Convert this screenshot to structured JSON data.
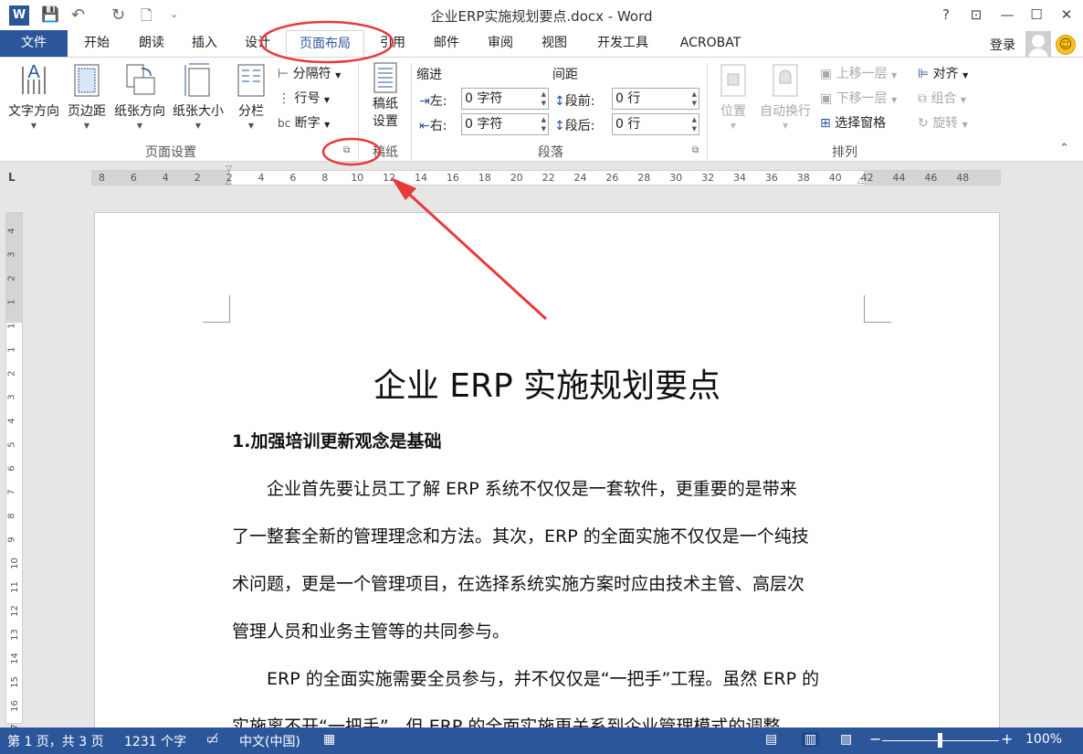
{
  "window": {
    "title": "企业ERP实施规划要点.docx - Word",
    "help": "?",
    "ribbon_display": "⊡",
    "minimize": "—",
    "maximize": "☐",
    "close": "✕"
  },
  "qat": {
    "app_icon": "W",
    "save": "💾",
    "undo": "↶",
    "redo": "↻",
    "print_preview": "🗋",
    "customize": "⌄"
  },
  "tabs": [
    {
      "label": "文件"
    },
    {
      "label": "开始"
    },
    {
      "label": "朗读"
    },
    {
      "label": "插入"
    },
    {
      "label": "设计"
    },
    {
      "label": "页面布局",
      "active": true
    },
    {
      "label": "引用"
    },
    {
      "label": "邮件"
    },
    {
      "label": "审阅"
    },
    {
      "label": "视图"
    },
    {
      "label": "开发工具"
    },
    {
      "label": "ACROBAT"
    }
  ],
  "account": {
    "login": "登录",
    "smiley": "☺"
  },
  "ribbon": {
    "page_setup": {
      "label": "页面设置",
      "text_direction": "文字方向",
      "margins": "页边距",
      "orientation": "纸张方向",
      "size": "纸张大小",
      "columns": "分栏",
      "breaks": "分隔符",
      "line_numbers": "行号",
      "hyphenation": "断字",
      "launcher": "⧉"
    },
    "manuscript": {
      "label": "稿纸",
      "settings_line1": "稿纸",
      "settings_line2": "设置"
    },
    "paragraph": {
      "label": "段落",
      "indent": "缩进",
      "spacing": "间距",
      "left_label": "左:",
      "right_label": "右:",
      "before_label": "段前:",
      "after_label": "段后:",
      "left_value": "0 字符",
      "right_value": "0 字符",
      "before_value": "0 行",
      "after_value": "0 行"
    },
    "arrange": {
      "label": "排列",
      "position": "位置",
      "wrap_text": "自动换行",
      "bring_forward": "上移一层",
      "send_backward": "下移一层",
      "selection_pane": "选择窗格",
      "align": "对齐",
      "group": "组合",
      "rotate": "旋转"
    },
    "collapse": "⌃"
  },
  "ruler": {
    "corner": "L",
    "h_ticks": [
      "8",
      "6",
      "4",
      "2",
      "2",
      "4",
      "6",
      "8",
      "10",
      "12",
      "14",
      "16",
      "18",
      "20",
      "22",
      "24",
      "26",
      "28",
      "30",
      "32",
      "34",
      "36",
      "38",
      "40",
      "42",
      "44",
      "46",
      "48"
    ],
    "v_ticks": [
      "4",
      "3",
      "2",
      "1",
      "1",
      "1",
      "2",
      "3",
      "4",
      "5",
      "6",
      "7",
      "8",
      "9",
      "10",
      "11",
      "12",
      "13",
      "14",
      "15",
      "16",
      "17"
    ]
  },
  "document": {
    "title": "企业 ERP 实施规划要点",
    "section1": "1.加强培训更新观念是基础",
    "para1_lines": [
      "　　企业首先要让员工了解 ERP 系统不仅仅是一套软件，更重要的是带来",
      "了一整套全新的管理理念和方法。其次，ERP 的全面实施不仅仅是一个纯技",
      "术问题，更是一个管理项目，在选择系统实施方案时应由技术主管、高层次",
      "管理人员和业务主管等的共同参与。"
    ],
    "para2_lines": [
      "　　ERP 的全面实施需要全员参与，并不仅仅是“一把手”工程。虽然 ERP 的",
      "实施离不开“一把手”，但 ERP 的全面实施更关系到企业管理模式的调整"
    ]
  },
  "status": {
    "page": "第 1 页，共 3 页",
    "words": "1231 个字",
    "language": "中文(中国)",
    "zoom": "100%",
    "zoom_minus": "−",
    "zoom_plus": "+"
  },
  "annotation_color": "#e8393b"
}
